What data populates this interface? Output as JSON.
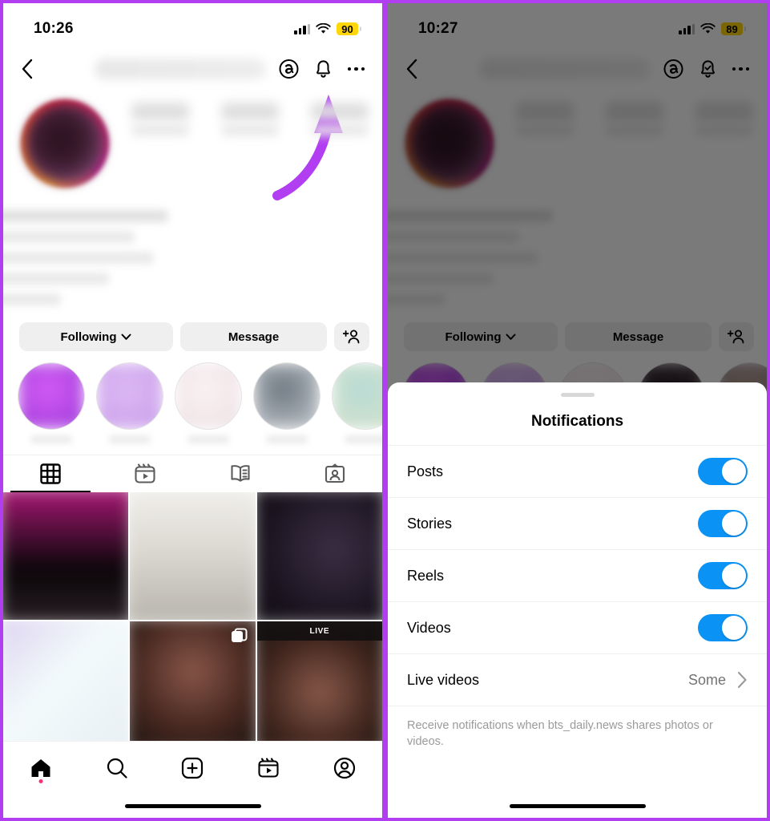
{
  "left_screen": {
    "status_bar": {
      "time": "10:26",
      "battery": "90",
      "signal_icon": "cellular-signal-icon",
      "wifi_icon": "wifi-icon",
      "battery_low_power_color": "#FFD60A"
    },
    "nav": {
      "back_icon": "back-chevron-icon",
      "username_redacted": "",
      "threads_icon": "threads-icon",
      "notifications_icon": "bell-icon",
      "more_icon": "more-options-icon"
    },
    "profile": {
      "avatar_icon": "profile-avatar",
      "stats": [
        {
          "value": "",
          "label": ""
        },
        {
          "value": "",
          "label": ""
        },
        {
          "value": "",
          "label": ""
        }
      ],
      "bio_lines": [
        "",
        "",
        "",
        "",
        ""
      ]
    },
    "actions": {
      "following_label": "Following",
      "following_chevron_icon": "chevron-down-icon",
      "message_label": "Message",
      "add_user_icon": "add-person-icon"
    },
    "highlights": [
      {
        "label": "",
        "color_a": "#d45cf5",
        "color_b": "#9b38d8"
      },
      {
        "label": "",
        "color_a": "#d9b3f2",
        "color_b": "#c79ce8"
      },
      {
        "label": "",
        "color_a": "#f6eef0",
        "color_b": "#ecdfe2"
      },
      {
        "label": "",
        "color_a": "#6e7780",
        "color_b": "#4f565e"
      },
      {
        "label": "",
        "color_a": "#b8dbd6",
        "color_b": "#8fbfc4"
      }
    ],
    "tabs": [
      {
        "name": "grid-tab",
        "icon": "grid-icon",
        "active": true
      },
      {
        "name": "reels-tab",
        "icon": "reels-icon",
        "active": false
      },
      {
        "name": "guides-tab",
        "icon": "guides-book-icon",
        "active": false
      },
      {
        "name": "tagged-tab",
        "icon": "tagged-person-icon",
        "active": false
      }
    ],
    "grid_posts": [
      {
        "name": "post-1",
        "color_a": "#b0197a",
        "color_b": "#0a0608",
        "badge": ""
      },
      {
        "name": "post-2",
        "color_a": "#e7e5e0",
        "color_b": "#bfbcb4",
        "badge": ""
      },
      {
        "name": "post-3",
        "color_a": "#2a2030",
        "color_b": "#151018",
        "badge": ""
      },
      {
        "name": "post-4",
        "color_a": "#eef6f7",
        "color_b": "#dfe9ef",
        "badge": ""
      },
      {
        "name": "post-5",
        "color_a": "#6b443b",
        "color_b": "#1c1210",
        "badge": "carousel-icon"
      },
      {
        "name": "post-6",
        "color_a": "#7a4d40",
        "color_b": "#2a1a16",
        "badge": "LIVE"
      }
    ],
    "bottom_nav": [
      {
        "name": "home-nav-item",
        "icon": "home-icon",
        "active": true,
        "has_badge": true
      },
      {
        "name": "search-nav-item",
        "icon": "search-icon",
        "active": false,
        "has_badge": false
      },
      {
        "name": "create-nav-item",
        "icon": "plus-square-icon",
        "active": false,
        "has_badge": false
      },
      {
        "name": "reels-nav-item",
        "icon": "reels-icon",
        "active": false,
        "has_badge": false
      },
      {
        "name": "profile-nav-item",
        "icon": "profile-circle-icon",
        "active": false,
        "has_badge": false
      }
    ],
    "annotation": {
      "arrow_icon": "pointing-arrow-annotation",
      "color": "#b13ef0",
      "points_to": "bell-icon"
    }
  },
  "right_screen": {
    "status_bar": {
      "time": "10:27",
      "battery": "89"
    },
    "nav": {
      "notifications_icon": "bell-check-icon"
    },
    "sheet": {
      "grabber_icon": "sheet-grabber",
      "title": "Notifications",
      "rows": [
        {
          "label": "Posts",
          "type": "toggle",
          "on": true
        },
        {
          "label": "Stories",
          "type": "toggle",
          "on": true
        },
        {
          "label": "Reels",
          "type": "toggle",
          "on": true
        },
        {
          "label": "Videos",
          "type": "toggle",
          "on": true
        },
        {
          "label": "Live videos",
          "type": "value",
          "value": "Some",
          "chevron_icon": "chevron-right-icon"
        }
      ],
      "footer": "Receive notifications when bts_daily.news shares photos or videos.",
      "toggle_on_color": "#0A93F5"
    }
  },
  "theme": {
    "frame_border": "#b13ef0",
    "accent_blue": "#0A93F5",
    "badge_pink": "#FF2D78"
  }
}
